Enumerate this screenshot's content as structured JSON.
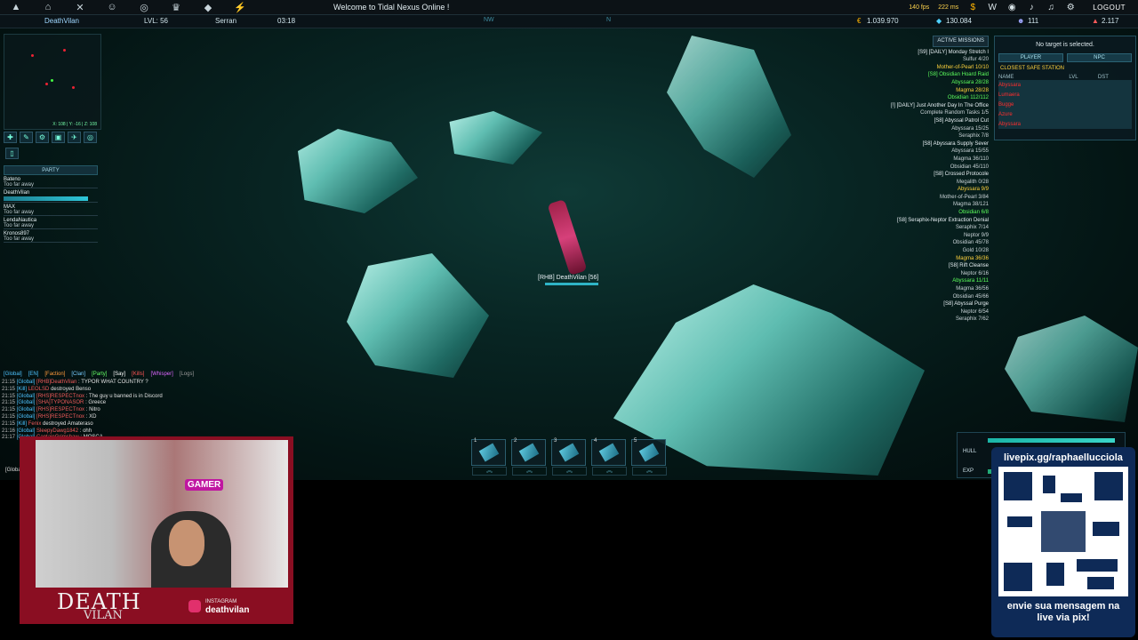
{
  "topbar": {
    "icons": [
      "ship-icon",
      "station-icon",
      "group-icon",
      "crossed-tools-icon",
      "map-target-icon",
      "trophy-icon",
      "shield-badge-icon",
      "lightning-bolt-icon"
    ],
    "welcome": "Welcome to Tidal Nexus Online !",
    "fps": "140 fps",
    "ping": "222 ms",
    "logout": "LOGOUT"
  },
  "status": {
    "player": "DeathVilan",
    "level": "LVL: 56",
    "faction": "Serran",
    "time": "03:18",
    "compass_nw": "NW",
    "compass_n": "N",
    "credits": "1.039.970",
    "gems": "130.084",
    "members": "111",
    "rp": "2.117"
  },
  "minimap": {
    "coords": "X: 108 | Y: -16 | Z: 108"
  },
  "party": {
    "header": "PARTY",
    "members": [
      {
        "name": "Bateno",
        "status": "Too far away"
      },
      {
        "name": "DeathVilan",
        "status": ""
      },
      {
        "name": "MAX",
        "status": "Too far away"
      },
      {
        "name": "LendaNautica",
        "status": "Too far away"
      },
      {
        "name": "Kronos897",
        "status": "Too far away"
      }
    ]
  },
  "chat": {
    "tabs": [
      "[Global]",
      "[EN]",
      "[Faction]",
      "[Clan]",
      "[Party]",
      "[Say]",
      "[Kills]",
      "[Whisper]",
      "[Logs]"
    ],
    "lines": [
      {
        "time": "21:15",
        "ch": "[Global]",
        "who": "[RHB]DeathVilan",
        "text": ": TYPOR WHAT COUNTRY ?"
      },
      {
        "time": "21:15",
        "ch": "[Kill]",
        "who": "LEOLSD",
        "text": "destroyed Benso"
      },
      {
        "time": "21:15",
        "ch": "[Global]",
        "who": "[RHS]RESPECTnox",
        "text": ": The guy u banned is in Discord"
      },
      {
        "time": "21:15",
        "ch": "[Global]",
        "who": "[SHA]TYPONASOR",
        "text": ": Greece"
      },
      {
        "time": "21:15",
        "ch": "[Global]",
        "who": "[RHS]RESPECTnox",
        "text": ": Nitro"
      },
      {
        "time": "21:15",
        "ch": "[Global]",
        "who": "[RHS]RESPECTnox",
        "text": ": XD"
      },
      {
        "time": "21:15",
        "ch": "[Kill]",
        "who": "Fenix",
        "text": "destroyed Amateraso"
      },
      {
        "time": "21:16",
        "ch": "[Global]",
        "who": "SleepyDawg1842",
        "text": ": ohh"
      },
      {
        "time": "21:17",
        "ch": "[Global]",
        "who": "CaptainGrimshaw",
        "text": ": MOSCA"
      }
    ],
    "input_label": "[Global]"
  },
  "hotbar": {
    "slots": [
      "1",
      "2",
      "3",
      "4",
      "5"
    ]
  },
  "player_tag": "[RHB] DeathVilan [56]",
  "missions": {
    "header": "ACTIVE MISSIONS",
    "items": [
      {
        "title": "[S9] [DAILY] Monday Stretch I",
        "done": false,
        "steps": [
          {
            "t": "Sulfur 4/20",
            "s": ""
          },
          {
            "t": "Mother-of-Pearl 10/10",
            "s": "warn"
          }
        ]
      },
      {
        "title": "[S8] Obsidian Hoard Raid",
        "done": true,
        "steps": [
          {
            "t": "Abyssara 28/28",
            "s": "ok"
          },
          {
            "t": "Magma 28/28",
            "s": "warn"
          },
          {
            "t": "Obsidian 112/112",
            "s": "ok"
          }
        ]
      },
      {
        "title": "[!] [DAILY] Just Another Day In The Office",
        "done": false,
        "steps": [
          {
            "t": "Complete Random Tasks 1/5",
            "s": ""
          }
        ]
      },
      {
        "title": "[S8] Abyssal Patrol Cut",
        "done": false,
        "steps": [
          {
            "t": "Abyssara 15/25",
            "s": ""
          },
          {
            "t": "Seraphix 7/8",
            "s": ""
          }
        ]
      },
      {
        "title": "[S8] Abyssara Supply Sever",
        "done": false,
        "steps": [
          {
            "t": "Abyssara 15/55",
            "s": ""
          },
          {
            "t": "Magma 36/110",
            "s": ""
          },
          {
            "t": "Obsidian 45/110",
            "s": ""
          }
        ]
      },
      {
        "title": "[S8] Crossed Protocole",
        "done": false,
        "steps": [
          {
            "t": "Megalith 0/28",
            "s": ""
          },
          {
            "t": "Abyssara 9/9",
            "s": "warn"
          },
          {
            "t": "Mother-of-Pearl 3/84",
            "s": ""
          },
          {
            "t": "Magma 38/121",
            "s": ""
          },
          {
            "t": "Obsidian 6/8",
            "s": "ok"
          }
        ]
      },
      {
        "title": "[S8] Seraphix-Neptor Extraction Denial",
        "done": false,
        "steps": [
          {
            "t": "Seraphix 7/14",
            "s": ""
          },
          {
            "t": "Neptor 9/9",
            "s": ""
          },
          {
            "t": "Obsidian 45/78",
            "s": ""
          },
          {
            "t": "Gold 10/28",
            "s": ""
          },
          {
            "t": "Magma 36/36",
            "s": "warn"
          }
        ]
      },
      {
        "title": "[S8] Rift Cleanse",
        "done": false,
        "steps": [
          {
            "t": "Neptor 6/16",
            "s": ""
          },
          {
            "t": "Abyssara 11/11",
            "s": "ok"
          },
          {
            "t": "Magma 36/56",
            "s": ""
          },
          {
            "t": "Obsidian 45/66",
            "s": ""
          }
        ]
      },
      {
        "title": "[S8] Abyssal Purge",
        "done": false,
        "steps": [
          {
            "t": "Neptor 6/54",
            "s": ""
          },
          {
            "t": "Seraphix 7/62",
            "s": ""
          }
        ]
      }
    ]
  },
  "target": {
    "none": "No target is selected.",
    "player_btn": "PLAYER",
    "npc_btn": "NPC",
    "safe": "CLOSEST SAFE STATION",
    "cols": [
      "NAME",
      "LVL",
      "DST"
    ],
    "rows": [
      "Abyssara",
      "Lumaera",
      "Bugge",
      "Azure",
      "Abyssara"
    ]
  },
  "hull": {
    "hull": "HULL",
    "exp": "EXP",
    "hull_fill": 0.95,
    "exp_fill": 0.2
  },
  "webcam": {
    "badge": "GAMER",
    "brand": "DEATH",
    "brand2": "VILAN",
    "ig_label": "INSTAGRAM",
    "ig_handle": "deathvilan"
  },
  "pix": {
    "url": "livepix.gg/raphaellucciola",
    "msg1": "envie sua mensagem na",
    "msg2": "live via pix!"
  }
}
